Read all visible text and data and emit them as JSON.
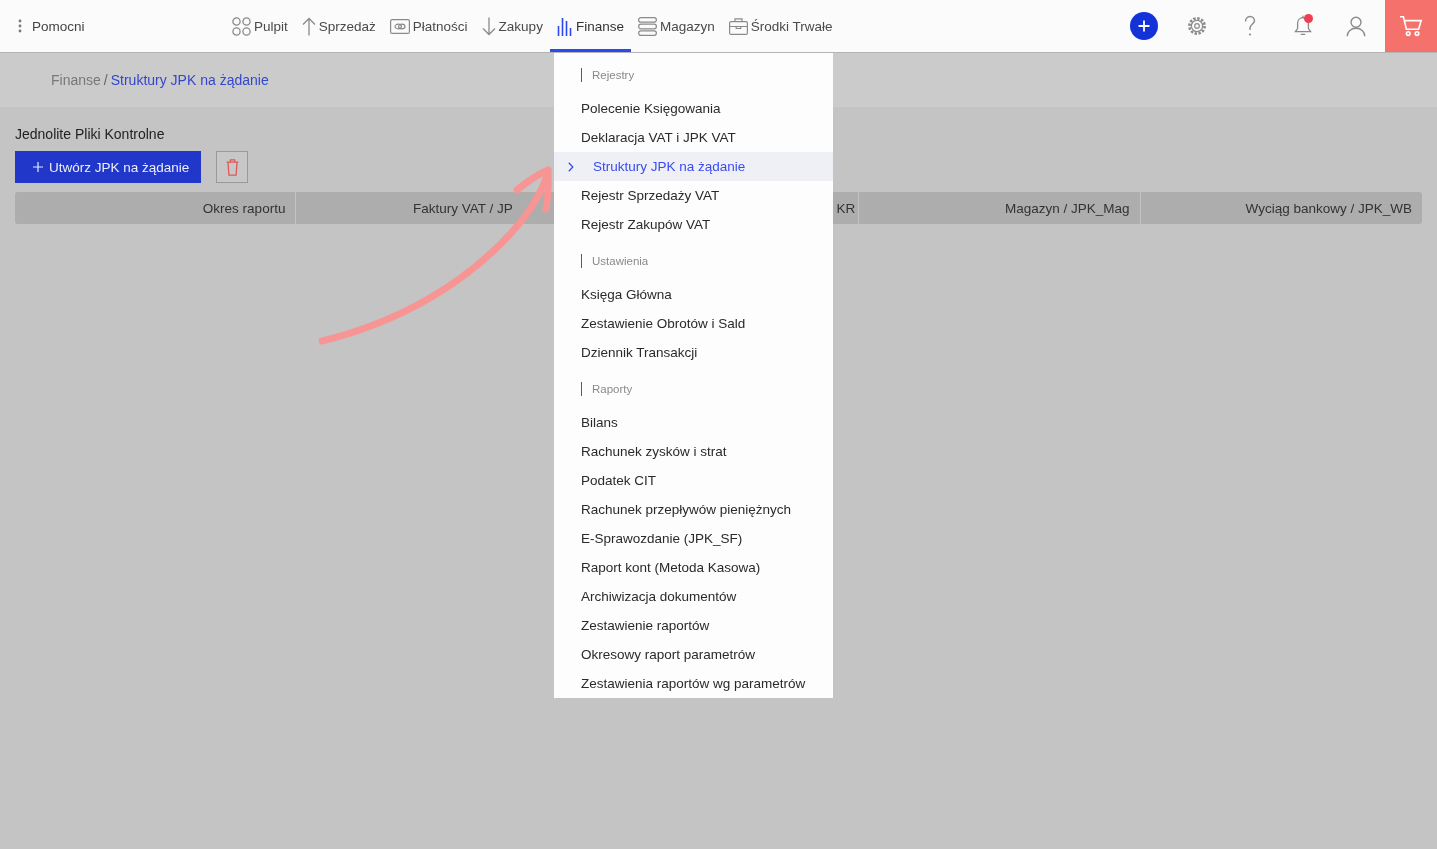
{
  "top_bar": {
    "helpers_label": "Pomocni",
    "nav": [
      {
        "label": "Pulpit",
        "selected": false
      },
      {
        "label": "Sprzedaż",
        "selected": false
      },
      {
        "label": "Płatności",
        "selected": false
      },
      {
        "label": "Zakupy",
        "selected": false
      },
      {
        "label": "Finanse",
        "selected": true
      },
      {
        "label": "Magazyn",
        "selected": false
      },
      {
        "label": "Środki Trwałe",
        "selected": false
      }
    ],
    "notifications_unread": true
  },
  "breadcrumb": {
    "items": [
      {
        "label": "Finanse",
        "current": false
      },
      {
        "label": "Struktury JPK na żądanie",
        "current": true
      }
    ],
    "separator": "/"
  },
  "page": {
    "title": "Jednolite Pliki Kontrolne",
    "create_button": "Utwórz JPK na żądanie"
  },
  "table": {
    "columns": [
      "Okres raportu",
      "Faktury VAT / JP",
      "KR",
      "Magazyn / JPK_Mag",
      "Wyciąg bankowy / JPK_WB"
    ]
  },
  "menu": {
    "sections": [
      {
        "title": "Rejestry",
        "items": [
          {
            "label": "Polecenie Księgowania",
            "selected": false
          },
          {
            "label": "Deklaracja VAT i JPK VAT",
            "selected": false
          },
          {
            "label": "Struktury JPK na żądanie",
            "selected": true
          },
          {
            "label": "Rejestr Sprzedaży VAT",
            "selected": false
          },
          {
            "label": "Rejestr Zakupów VAT",
            "selected": false
          }
        ]
      },
      {
        "title": "Ustawienia",
        "items": [
          {
            "label": "Księga Główna",
            "selected": false
          },
          {
            "label": "Zestawienie Obrotów i Sald",
            "selected": false
          },
          {
            "label": "Dziennik Transakcji",
            "selected": false
          }
        ]
      },
      {
        "title": "Raporty",
        "items": [
          {
            "label": "Bilans",
            "selected": false
          },
          {
            "label": "Rachunek zysków i strat",
            "selected": false
          },
          {
            "label": "Podatek CIT",
            "selected": false
          },
          {
            "label": "Rachunek przepływów pieniężnych",
            "selected": false
          },
          {
            "label": "E-Sprawozdanie (JPK_SF)",
            "selected": false
          },
          {
            "label": "Raport kont (Metoda Kasowa)",
            "selected": false
          },
          {
            "label": "Archiwizacja dokumentów",
            "selected": false
          },
          {
            "label": "Zestawienie raportów",
            "selected": false
          },
          {
            "label": "Okresowy raport parametrów",
            "selected": false
          },
          {
            "label": "Zestawienia raportów wg parametrów",
            "selected": false
          }
        ]
      }
    ]
  },
  "annotations": [
    {
      "kind": "arrow"
    }
  ]
}
